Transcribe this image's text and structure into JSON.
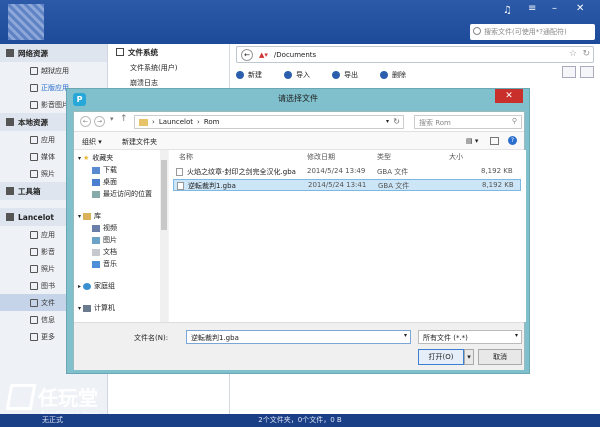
{
  "topbar": {
    "search_placeholder": "搜索文件(可使用*?通配符)",
    "music_icon": "music-note-icon"
  },
  "sidebar": {
    "sections": [
      {
        "title": "网络资源",
        "items": [
          {
            "label": "越狱应用"
          },
          {
            "label": "正版应用",
            "active": true
          },
          {
            "label": "影音图片"
          }
        ]
      },
      {
        "title": "本地资源",
        "items": [
          {
            "label": "应用"
          },
          {
            "label": "媒体"
          },
          {
            "label": "照片"
          }
        ]
      },
      {
        "title": "工具箱",
        "items": []
      },
      {
        "title": "Lancelot",
        "items": [
          {
            "label": "应用"
          },
          {
            "label": "影音"
          },
          {
            "label": "照片"
          },
          {
            "label": "图书"
          },
          {
            "label": "文件",
            "selected": true
          },
          {
            "label": "信息"
          },
          {
            "label": "更多"
          }
        ]
      }
    ]
  },
  "tree": {
    "title": "文件系统",
    "nodes": [
      "文件系统(用户)",
      "崩溃日志"
    ]
  },
  "main": {
    "path": "/Documents",
    "toolbar": [
      "新建",
      "导入",
      "导出",
      "删除"
    ]
  },
  "dialog": {
    "title": "请选择文件",
    "path_segments": [
      "Launcelot",
      "Rom"
    ],
    "search_placeholder": "搜索 Rom",
    "organize": "组织 ▾",
    "new_folder": "新建文件夹",
    "nav": {
      "favorites": "收藏夹",
      "fav_items": [
        "下载",
        "桌面",
        "最近访问的位置"
      ],
      "library": "库",
      "lib_items": [
        "视频",
        "图片",
        "文档",
        "音乐"
      ],
      "homegroup": "家庭组",
      "computer": "计算机"
    },
    "columns": {
      "name": "名称",
      "date": "修改日期",
      "type": "类型",
      "size": "大小"
    },
    "files": [
      {
        "name": "火焰之纹章-封印之剑完全汉化.gba",
        "date": "2014/5/24 13:49",
        "type": "GBA 文件",
        "size": "8,192 KB"
      },
      {
        "name": "逆転裁判1.gba",
        "date": "2014/5/24 13:41",
        "type": "GBA 文件",
        "size": "8,192 KB",
        "selected": true
      }
    ],
    "filename_label": "文件名(N):",
    "filename_value": "逆転裁判1.gba",
    "filetype": "所有文件 (*.*)",
    "open_label": "打开(O)",
    "cancel_label": "取消"
  },
  "status": {
    "text": "2个文件夹，0个文件，0 B",
    "user": "无正式"
  },
  "watermark": {
    "big": "任玩堂",
    "small": "AppGame.com"
  }
}
